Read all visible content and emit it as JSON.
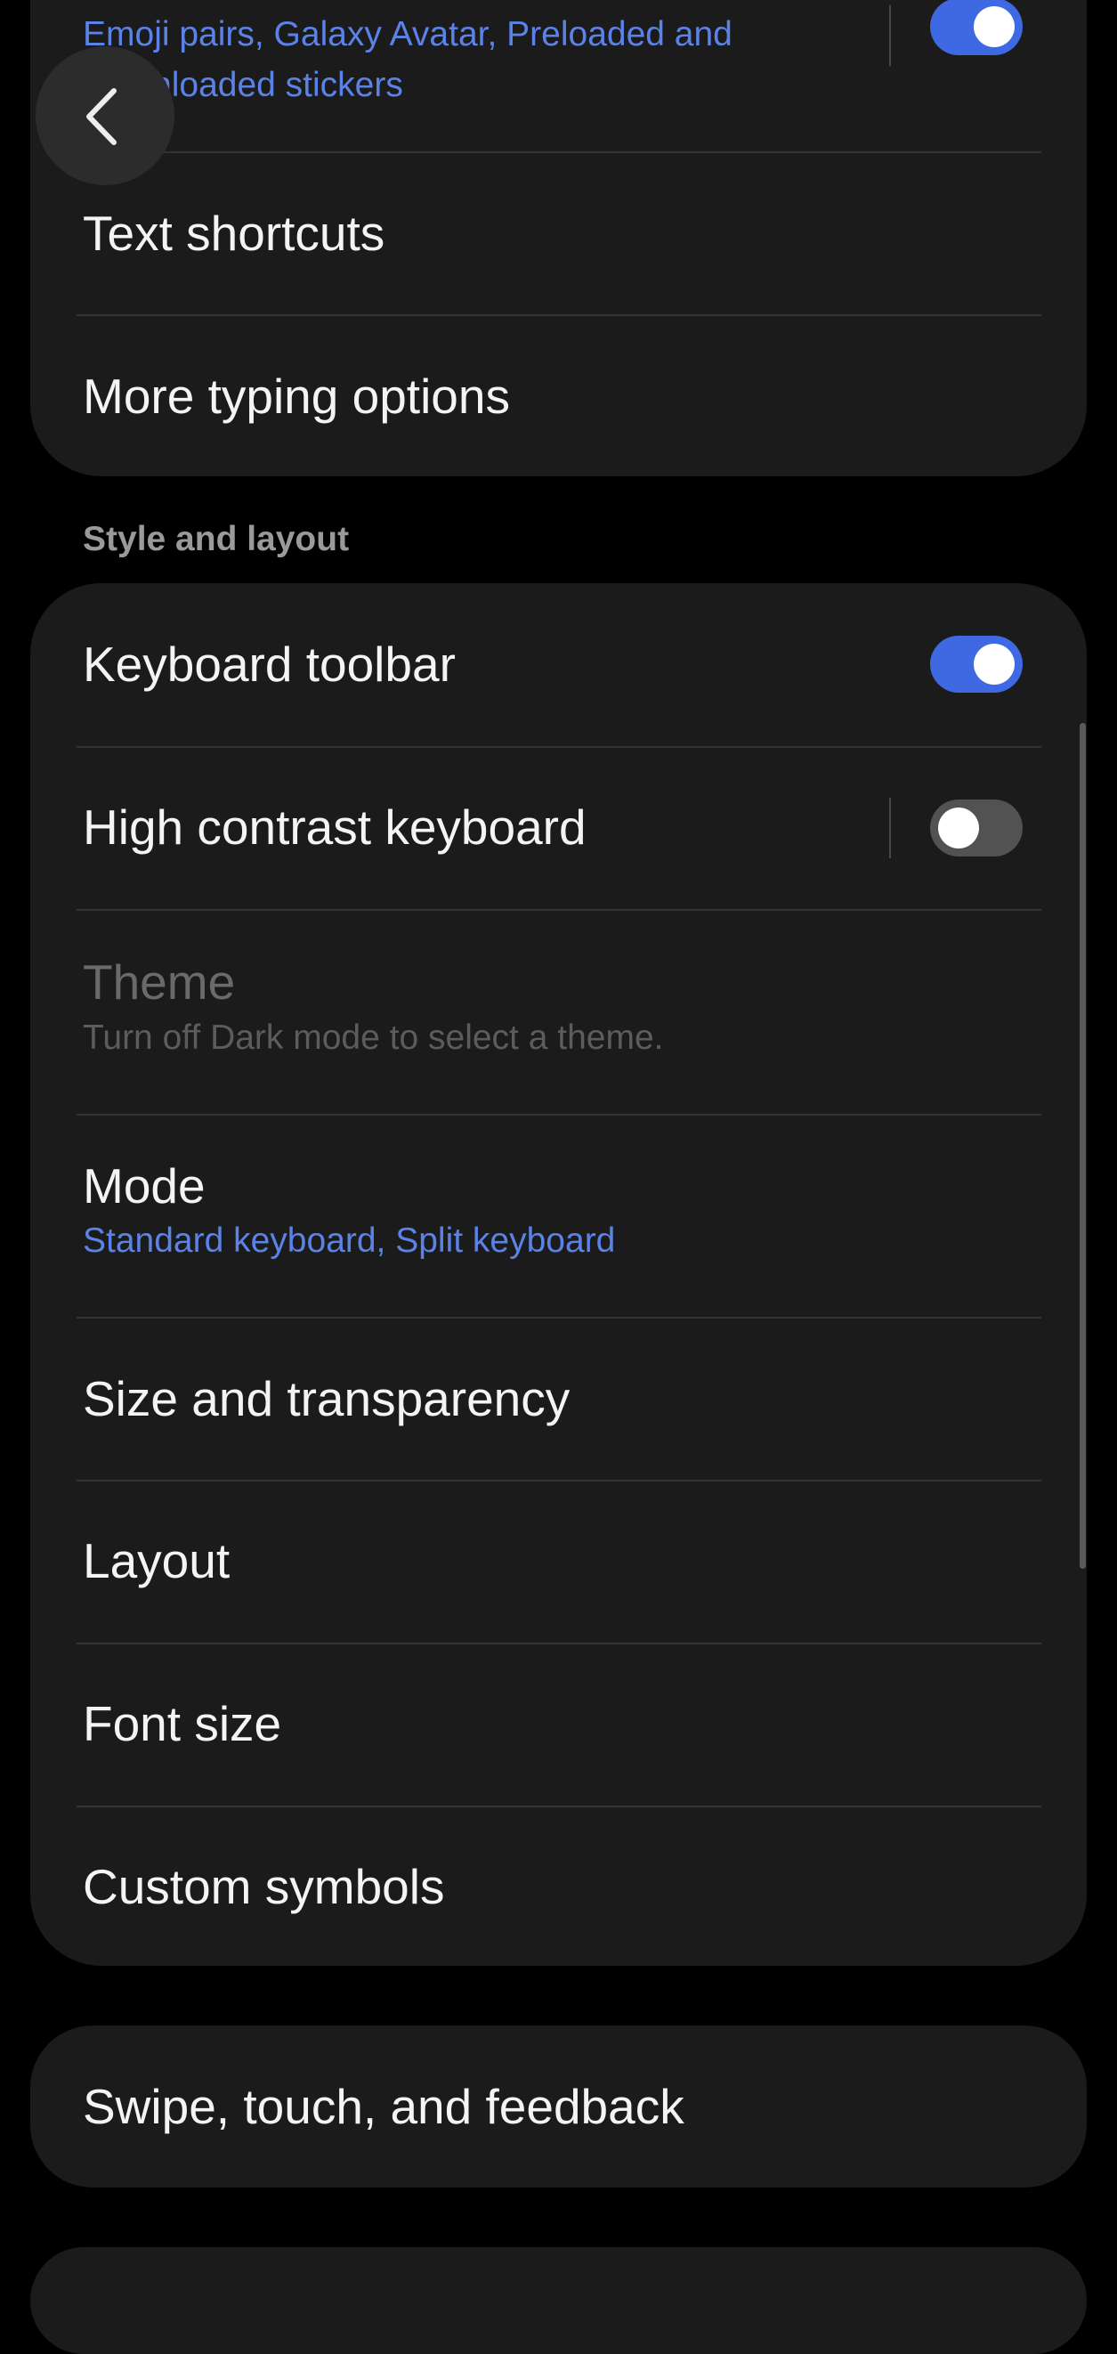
{
  "top_card": {
    "suggestions_subtitle_line1": "Emoji pairs, Galaxy Avatar, Preloaded and",
    "suggestions_subtitle_line2": "Downloaded stickers",
    "suggestions_toggle_on": true,
    "items": [
      {
        "label": "Text shortcuts"
      },
      {
        "label": "More typing options"
      }
    ]
  },
  "style_layout": {
    "header": "Style and layout",
    "keyboard_toolbar": {
      "label": "Keyboard toolbar",
      "on": true
    },
    "high_contrast": {
      "label": "High contrast keyboard",
      "on": false
    },
    "theme": {
      "label": "Theme",
      "subtitle": "Turn off Dark mode to select a theme."
    },
    "mode": {
      "label": "Mode",
      "subtitle": "Standard keyboard, Split keyboard"
    },
    "items": [
      {
        "label": "Size and transparency"
      },
      {
        "label": "Layout"
      },
      {
        "label": "Font size"
      },
      {
        "label": "Custom symbols"
      }
    ]
  },
  "swipe_card": {
    "label": "Swipe, touch, and feedback"
  },
  "icons": {
    "back": "chevron-left-icon"
  },
  "colors": {
    "accent": "#3f69e3",
    "link_text": "#5b82e6",
    "card_bg": "#1b1b1b",
    "page_bg": "#000000"
  }
}
